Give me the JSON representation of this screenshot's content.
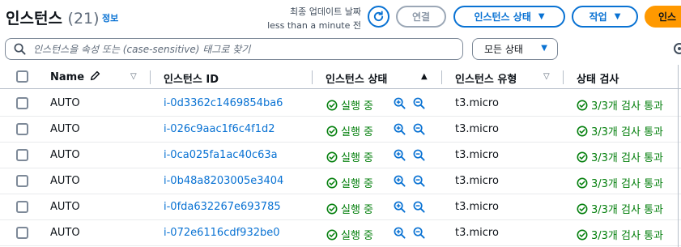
{
  "header": {
    "title": "인스턴스",
    "count": "(21)",
    "info_link": "정보",
    "last_updated_line1": "최종 업데이트 날짜",
    "last_updated_line2": "less than a minute 전",
    "connect_label": "연결",
    "instance_state_label": "인스턴스 상태",
    "actions_label": "작업",
    "launch_label": "인스"
  },
  "filter": {
    "search_placeholder": "인스턴스을 속성 또는 (case-sensitive) 태그로 찾기",
    "state_select_value": "모든 상태"
  },
  "table": {
    "columns": {
      "name": "Name",
      "instance_id": "인스턴스 ID",
      "instance_state": "인스턴스 상태",
      "instance_type": "인스턴스 유형",
      "status_check": "상태 검사"
    },
    "rows": [
      {
        "name": "AUTO",
        "id": "i-0d3362c1469854ba6",
        "state": "실행 중",
        "type": "t3.micro",
        "check": "3/3개 검사 통과"
      },
      {
        "name": "AUTO",
        "id": "i-026c9aac1f6c4f1d2",
        "state": "실행 중",
        "type": "t3.micro",
        "check": "3/3개 검사 통과"
      },
      {
        "name": "AUTO",
        "id": "i-0ca025fa1ac40c63a",
        "state": "실행 중",
        "type": "t3.micro",
        "check": "3/3개 검사 통과"
      },
      {
        "name": "AUTO",
        "id": "i-0b48a8203005e3404",
        "state": "실행 중",
        "type": "t3.micro",
        "check": "3/3개 검사 통과"
      },
      {
        "name": "AUTO",
        "id": "i-0fda632267e693785",
        "state": "실행 중",
        "type": "t3.micro",
        "check": "3/3개 검사 통과"
      },
      {
        "name": "AUTO",
        "id": "i-072e6116cdf932be0",
        "state": "실행 중",
        "type": "t3.micro",
        "check": "3/3개 검사 통과"
      }
    ]
  },
  "icons": {
    "refresh": "refresh-icon",
    "search": "search-icon",
    "settings": "gear-icon",
    "edit": "pencil-icon",
    "status_ok": "check-circle-icon",
    "zoom_in": "zoom-in-icon",
    "zoom_out": "zoom-out-icon"
  },
  "colors": {
    "link_blue": "#0972d3",
    "success_green": "#037f0c",
    "launch_orange": "#ff9900"
  }
}
